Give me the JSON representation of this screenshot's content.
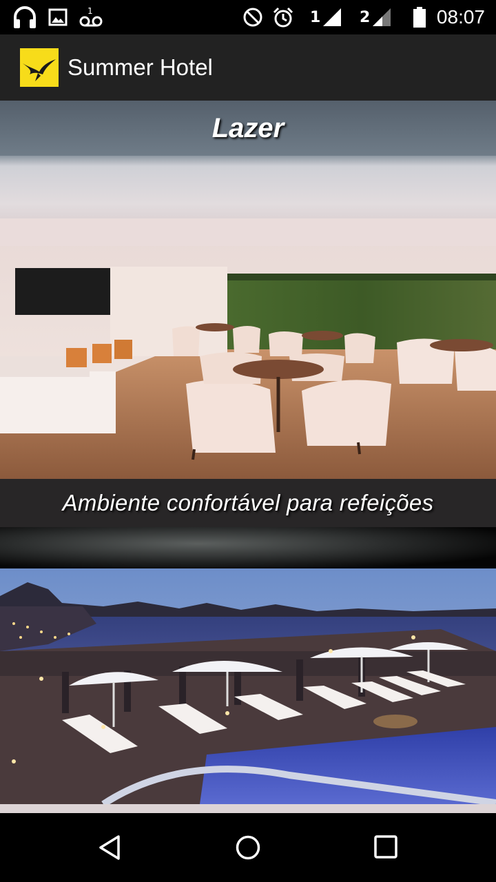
{
  "status_bar": {
    "time": "08:07",
    "sim1_label": "1",
    "sim2_label": "2",
    "icons": [
      "headphones-icon",
      "image-icon",
      "voicemail-icon",
      "do-not-disturb-icon",
      "alarm-icon",
      "signal-icon",
      "battery-icon"
    ]
  },
  "app_bar": {
    "title": "Summer Hotel",
    "logo_color": "#f7dc1a",
    "background": "#222222"
  },
  "section": {
    "title": "Lazer"
  },
  "gallery": [
    {
      "caption": "Ambiente confortável para refeições",
      "image": "hotel-lounge-photo"
    },
    {
      "caption": "",
      "image": "rooftop-pool-photo"
    }
  ],
  "nav_bar": {
    "buttons": [
      "back-icon",
      "home-icon",
      "recents-icon"
    ]
  }
}
